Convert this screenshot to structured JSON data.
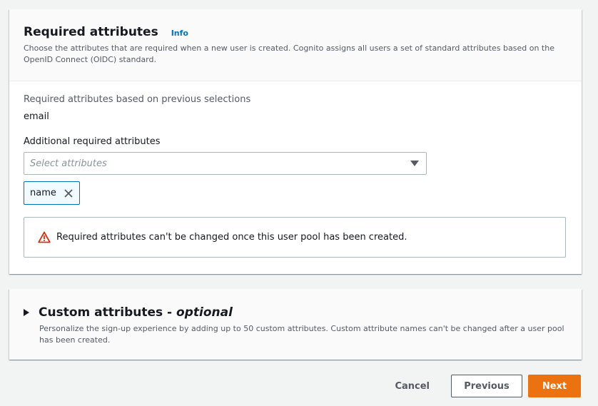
{
  "required_attributes": {
    "title": "Required attributes",
    "info_link": "Info",
    "description": "Choose the attributes that are required when a new user is created. Cognito assigns all users a set of standard attributes based on the OpenID Connect (OIDC) standard.",
    "previous_label": "Required attributes based on previous selections",
    "previous_value": "email",
    "additional_label": "Additional required attributes",
    "select_placeholder": "Select attributes",
    "tokens": [
      {
        "label": "name"
      }
    ],
    "alert_text": "Required attributes can't be changed once this user pool has been created."
  },
  "custom_attributes": {
    "title": "Custom attributes - ",
    "title_optional": "optional",
    "description": "Personalize the sign-up experience by adding up to 50 custom attributes. Custom attribute names can't be changed after a user pool has been created."
  },
  "footer": {
    "cancel_label": "Cancel",
    "previous_label": "Previous",
    "next_label": "Next"
  },
  "colors": {
    "accent_link": "#0073bb",
    "primary_button": "#ec7211",
    "warning_icon": "#d13212"
  },
  "icons": {
    "info": "info-link",
    "dropdown": "caret-down-icon",
    "token_remove": "close-icon",
    "alert": "warning-icon",
    "expand": "caret-right-icon"
  }
}
